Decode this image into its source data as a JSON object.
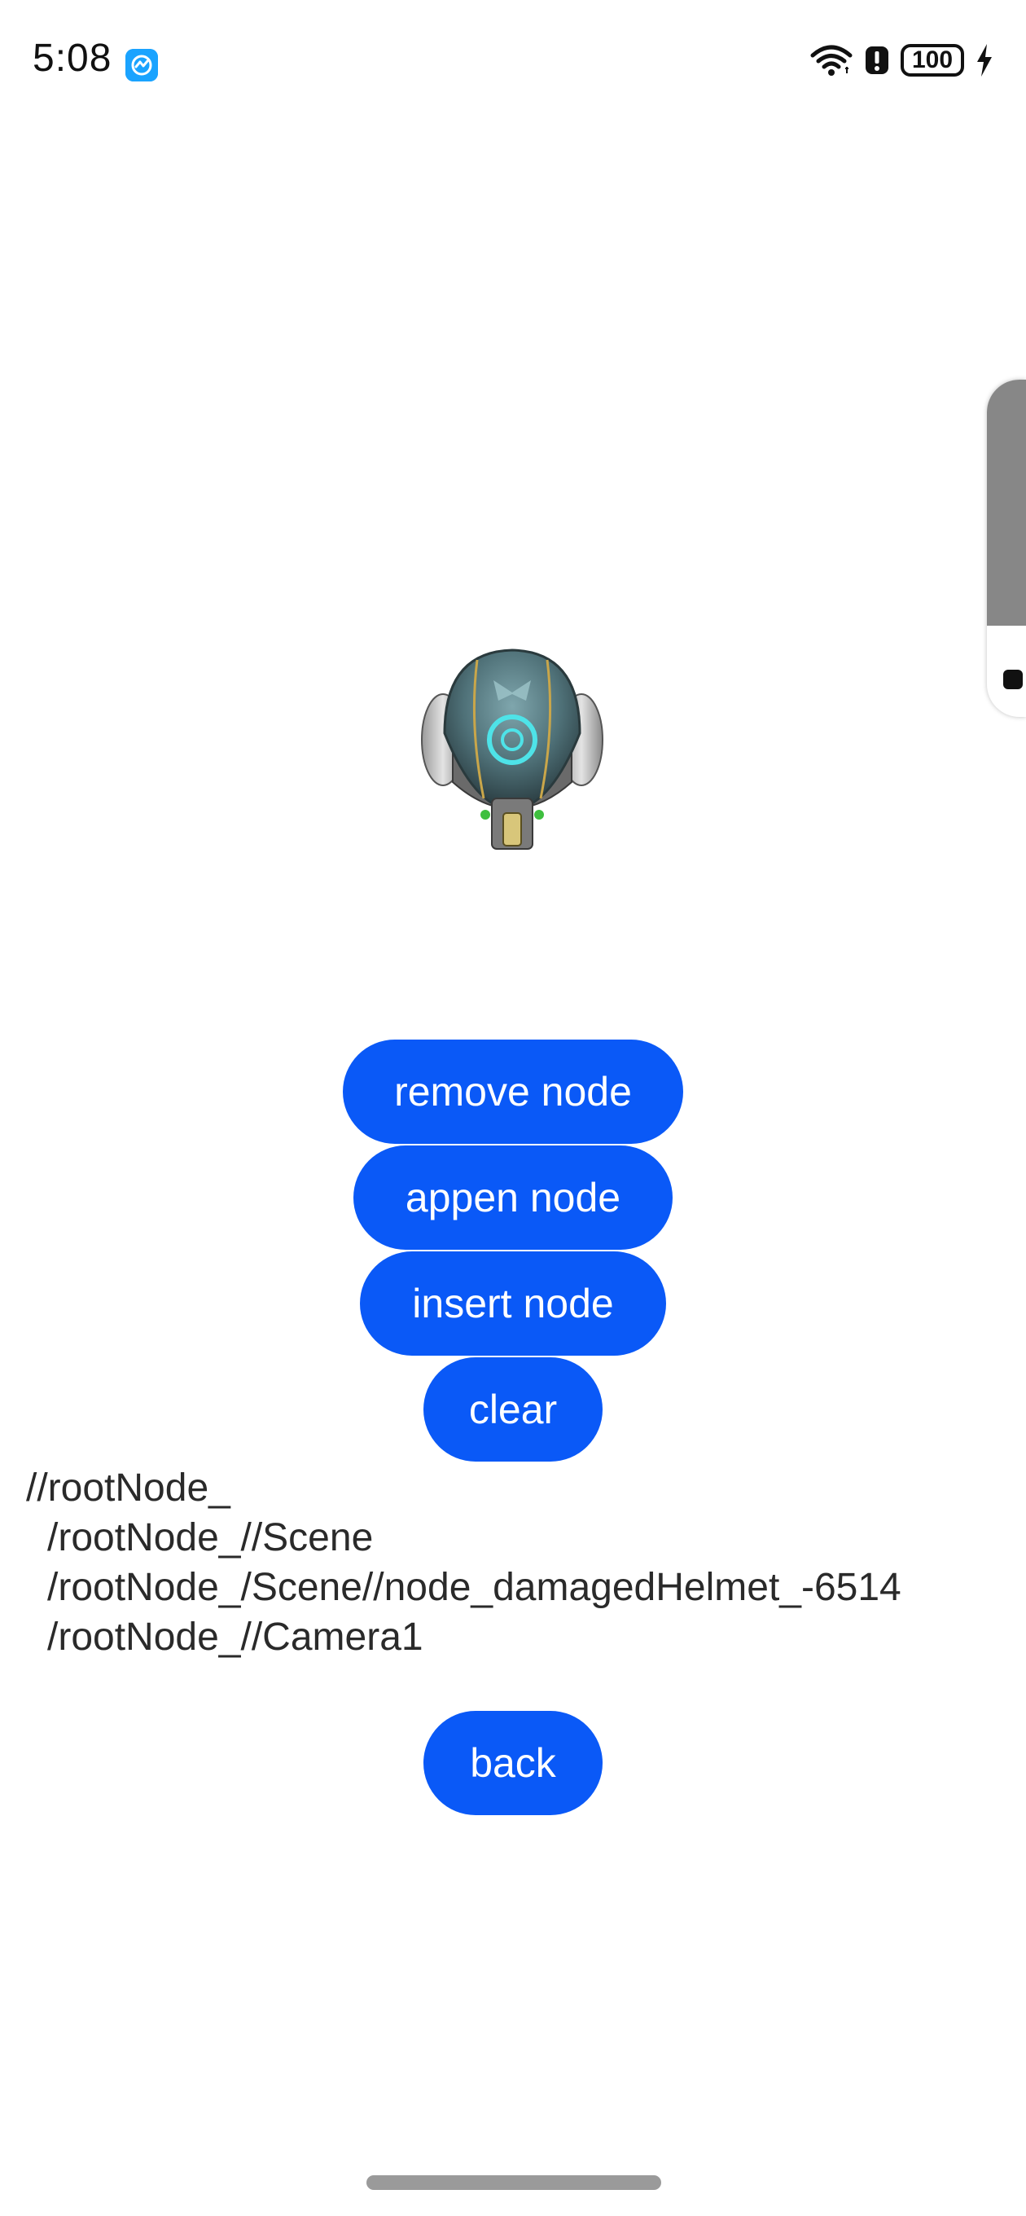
{
  "status_bar": {
    "time": "5:08",
    "battery": "100",
    "icons": [
      "app-indicator-icon",
      "wifi-icon",
      "alert-icon",
      "battery-icon",
      "charging-bolt-icon"
    ]
  },
  "scene": {
    "model": "helmet-model-icon"
  },
  "buttons": {
    "remove": "remove node",
    "append": "appen node",
    "insert": "insert node",
    "clear": "clear",
    "back": "back"
  },
  "node_tree": [
    "//rootNode_",
    "/rootNode_//Scene",
    "/rootNode_/Scene//node_damagedHelmet_-6514",
    "/rootNode_//Camera1"
  ],
  "colors": {
    "accent": "#0a59f7",
    "text": "#2a2a2a",
    "background": "#ffffff"
  }
}
